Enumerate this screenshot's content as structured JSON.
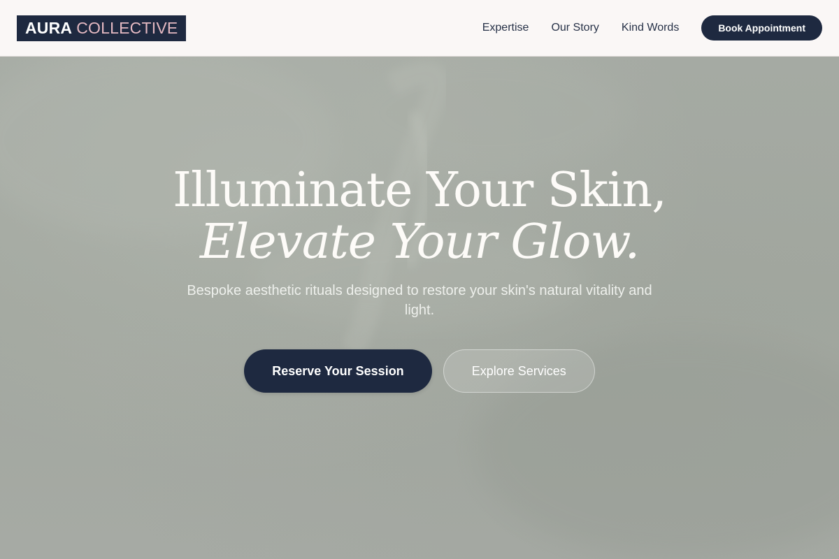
{
  "header": {
    "logo": {
      "strong": "AURA",
      "light": "COLLECTIVE"
    },
    "nav": [
      {
        "label": "Expertise"
      },
      {
        "label": "Our Story"
      },
      {
        "label": "Kind Words"
      }
    ],
    "cta_label": "Book Appointment"
  },
  "hero": {
    "headline_line1": "Illuminate Your Skin,",
    "headline_line2": "Elevate Your Glow.",
    "subtitle": "Bespoke aesthetic rituals designed to restore your skin's natural vitality and light.",
    "primary_cta": "Reserve Your Session",
    "secondary_cta": "Explore Services"
  },
  "colors": {
    "navy": "#1e2940",
    "logo_accent": "#e4b9c2",
    "header_bg": "#faf7f6",
    "hero_bg": "#a4a8a2"
  }
}
